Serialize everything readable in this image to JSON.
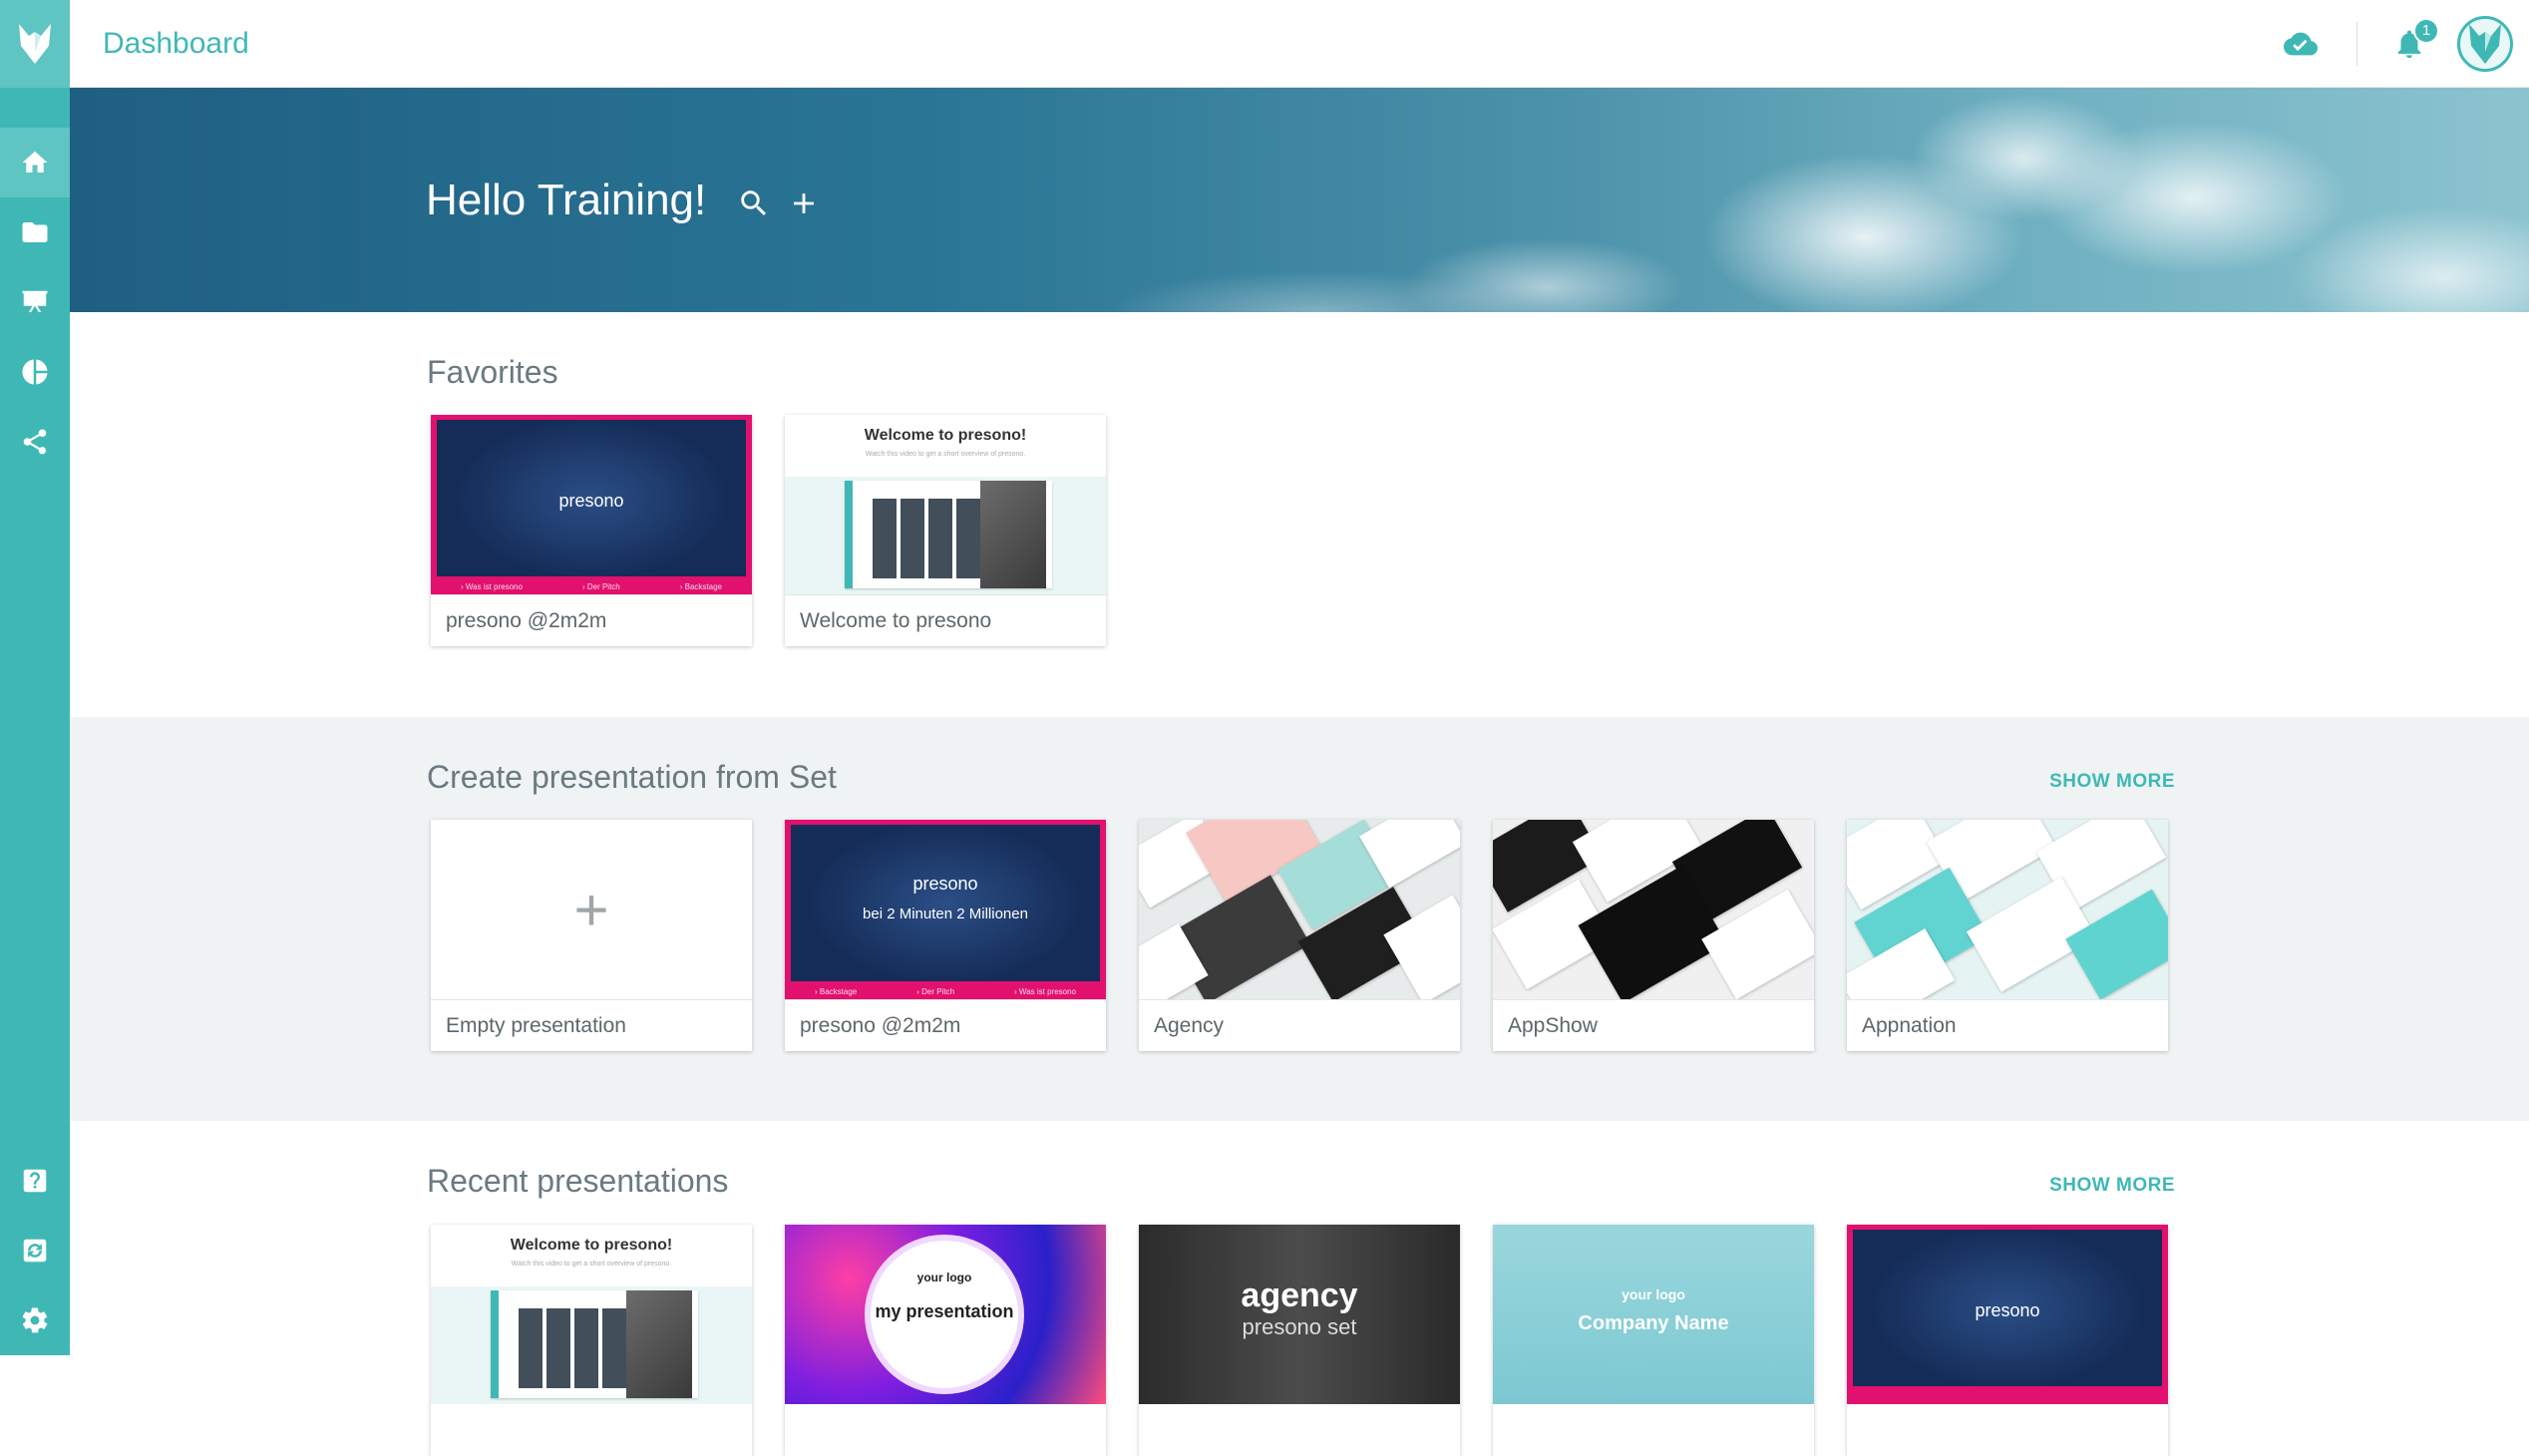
{
  "app": {
    "title": "Dashboard",
    "notification_count": "1"
  },
  "hero": {
    "greeting": "Hello Training!"
  },
  "favorites": {
    "title": "Favorites",
    "items": [
      {
        "label": "presono @2m2m",
        "thumb_logo": "presono",
        "thumb_strip": [
          "› Was ist presono",
          "› Der Pitch",
          "› Backstage"
        ]
      },
      {
        "label": "Welcome to presono",
        "thumb_title": "Welcome to presono!",
        "thumb_sub": "Watch this video to get a short overview of presono."
      }
    ]
  },
  "sets": {
    "title": "Create presentation from Set",
    "show_more": "SHOW MORE",
    "items": [
      {
        "label": "Empty presentation",
        "symbol": "+"
      },
      {
        "label": "presono @2m2m",
        "thumb_logo": "presono",
        "thumb_sub": "bei 2 Minuten 2 Millionen",
        "thumb_strip": [
          "› Backstage",
          "› Der Pitch",
          "› Was ist presono"
        ]
      },
      {
        "label": "Agency"
      },
      {
        "label": "AppShow"
      },
      {
        "label": "Appnation"
      }
    ]
  },
  "recent": {
    "title": "Recent presentations",
    "show_more": "SHOW MORE",
    "items": [
      {
        "thumb_title": "Welcome to presono!",
        "thumb_sub": "Watch this video to get a short overview of presono."
      },
      {
        "thumb_logo": "your logo",
        "thumb_title": "my presentation"
      },
      {
        "thumb_title": "agency",
        "thumb_sub": "presono set"
      },
      {
        "thumb_logo": "your logo",
        "thumb_title": "Company Name"
      },
      {
        "thumb_logo": "presono"
      }
    ]
  },
  "colors": {
    "accent": "#3fb8b5",
    "brand_pink": "#e2106e",
    "section_bg": "#eff3f4"
  },
  "icons": {
    "sidebar_top": [
      "home-icon",
      "folder-icon",
      "presentation-icon",
      "pie-chart-icon",
      "share-icon"
    ],
    "sidebar_bottom": [
      "help-icon",
      "sync-icon",
      "settings-icon"
    ],
    "topbar": [
      "cloud-done-icon",
      "bell-icon",
      "avatar"
    ]
  }
}
